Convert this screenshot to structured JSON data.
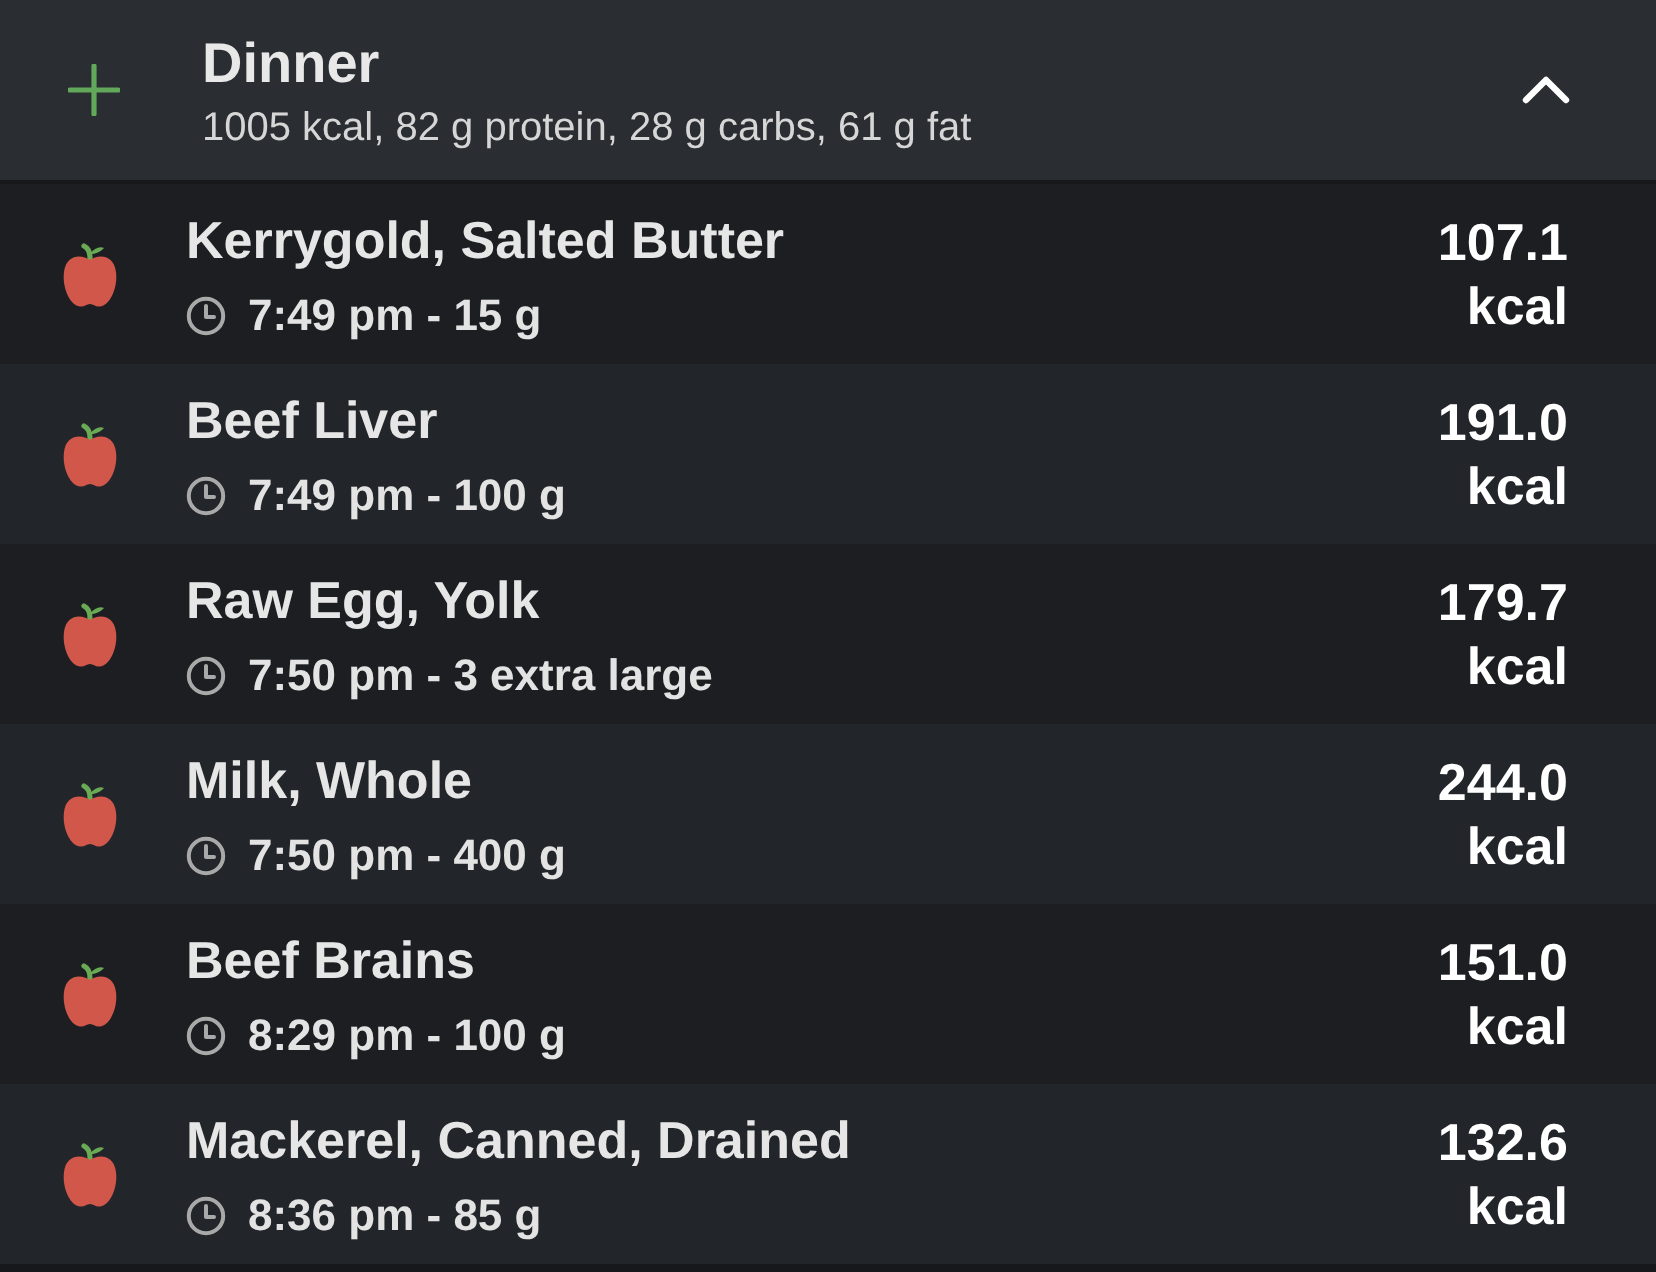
{
  "meal": {
    "title": "Dinner",
    "summary": "1005 kcal, 82 g protein, 28 g carbs, 61 g fat",
    "expanded": true
  },
  "entries": [
    {
      "name": "Kerrygold, Salted Butter",
      "detail": "7:49 pm - 15 g",
      "energy": "107.1",
      "unit": "kcal"
    },
    {
      "name": "Beef Liver",
      "detail": "7:49 pm - 100 g",
      "energy": "191.0",
      "unit": "kcal"
    },
    {
      "name": "Raw Egg, Yolk",
      "detail": "7:50 pm - 3 extra large",
      "energy": "179.7",
      "unit": "kcal"
    },
    {
      "name": "Milk, Whole",
      "detail": "7:50 pm - 400 g",
      "energy": "244.0",
      "unit": "kcal"
    },
    {
      "name": "Beef Brains",
      "detail": "8:29 pm - 100 g",
      "energy": "151.0",
      "unit": "kcal"
    },
    {
      "name": "Mackerel, Canned, Drained",
      "detail": "8:36 pm - 85 g",
      "energy": "132.6",
      "unit": "kcal"
    }
  ]
}
